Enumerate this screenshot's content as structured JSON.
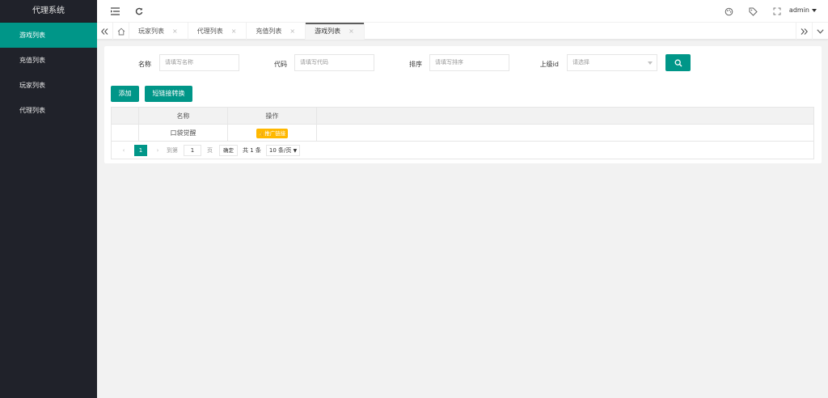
{
  "app": {
    "title": "代理系统"
  },
  "sidebar": {
    "items": [
      {
        "label": "游戏列表",
        "active": true
      },
      {
        "label": "充值列表",
        "active": false
      },
      {
        "label": "玩家列表",
        "active": false
      },
      {
        "label": "代理列表",
        "active": false
      }
    ]
  },
  "header": {
    "user": "admin"
  },
  "tabs": [
    {
      "label": "玩家列表",
      "close": "×"
    },
    {
      "label": "代理列表",
      "close": "×"
    },
    {
      "label": "充值列表",
      "close": "×"
    },
    {
      "label": "游戏列表",
      "close": "×",
      "active": true
    }
  ],
  "search_form": {
    "name_label": "名称",
    "name_placeholder": "请填写名称",
    "code_label": "代码",
    "code_placeholder": "请填写代码",
    "sort_label": "排序",
    "sort_placeholder": "请填写排序",
    "parent_label": "上级id",
    "parent_placeholder": "请选择"
  },
  "toolbar": {
    "add_label": "添加",
    "convert_label": "短链接转换"
  },
  "table": {
    "headers": [
      "名称",
      "操作"
    ],
    "rows": [
      {
        "name": "口袋觉醒",
        "action": "推广链接"
      }
    ]
  },
  "pager": {
    "current": "1",
    "goto_label": "到第",
    "page_input": "1",
    "page_suffix": "页",
    "confirm_label": "确定",
    "total": "共 1 条",
    "per_page": "10 条/页"
  },
  "colors": {
    "accent": "#009688",
    "sidebar_bg": "#20222a",
    "badge": "#ffb800"
  }
}
